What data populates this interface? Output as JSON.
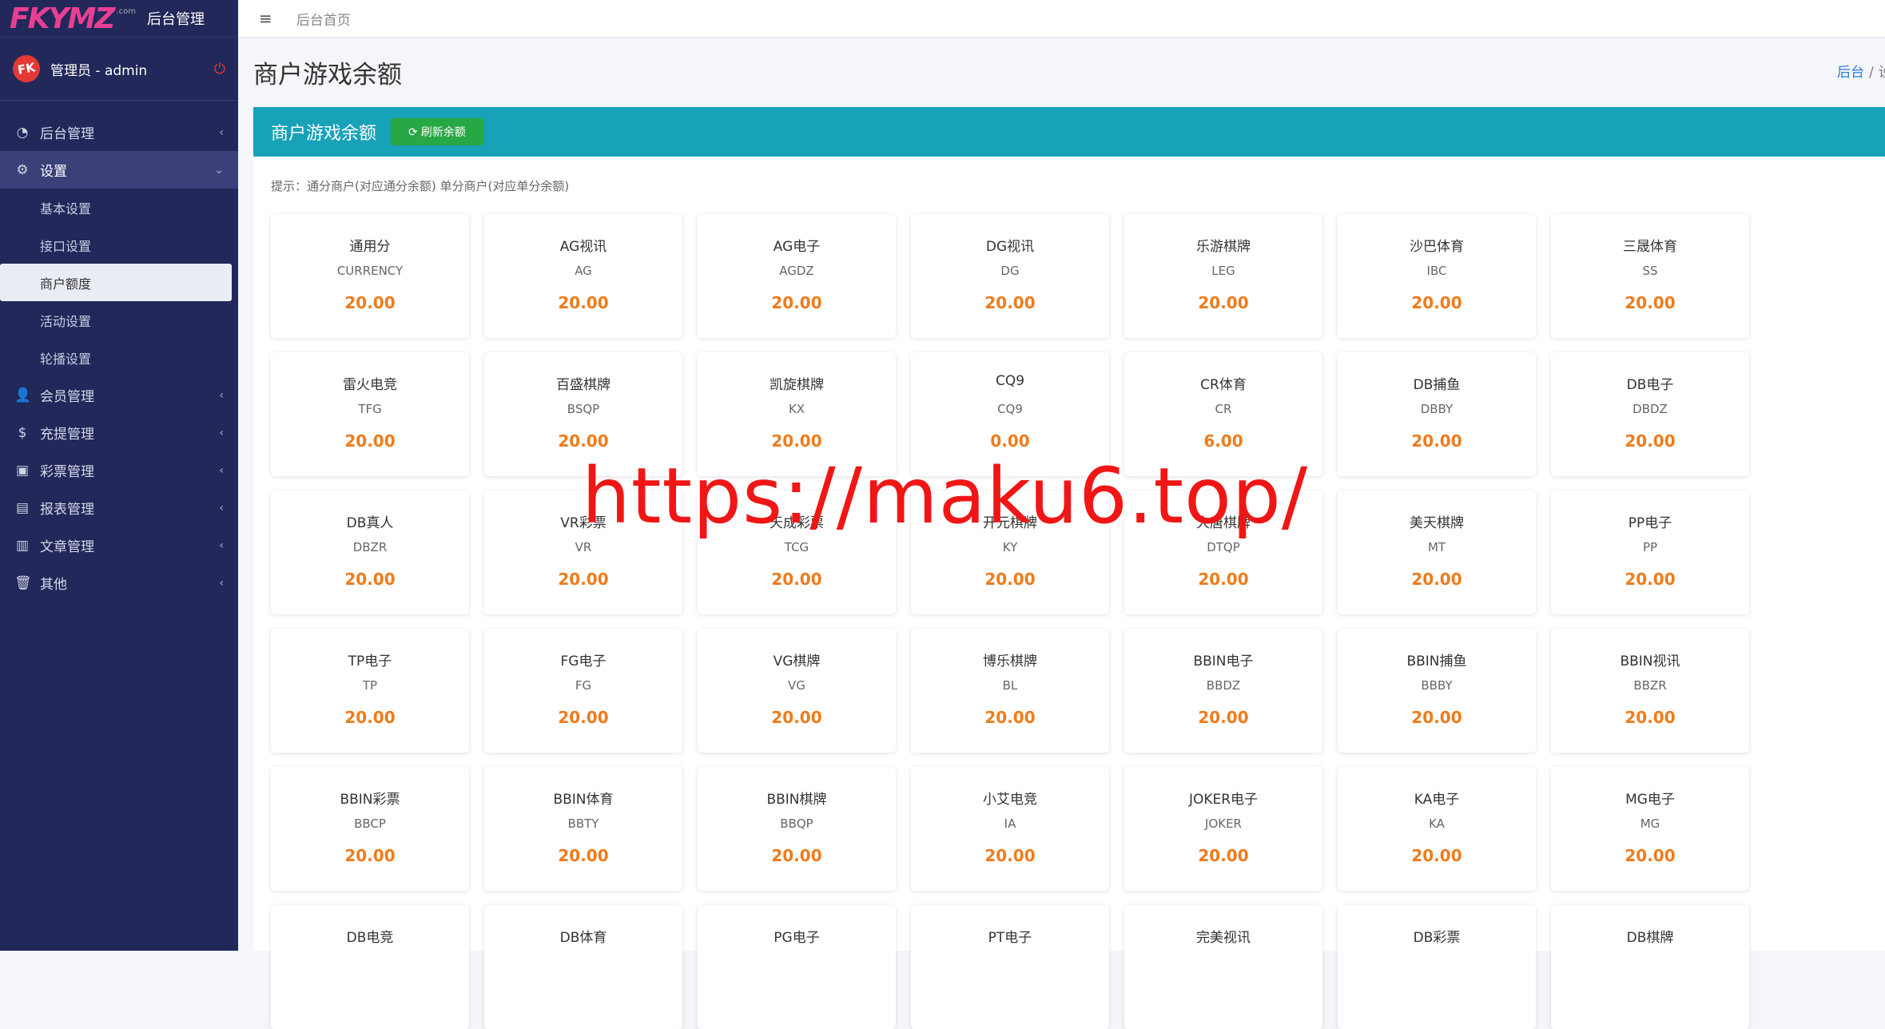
{
  "brand": {
    "logo_text": "FKYMZ",
    "logo_sup": ".com",
    "title": "后台管理"
  },
  "user": {
    "avatar_text": "FK",
    "name": "管理员 - admin"
  },
  "menu": [
    {
      "icon": "tachometer-icon",
      "glyph": "◔",
      "label": "后台管理",
      "type": "parent",
      "state": "collapsed"
    },
    {
      "icon": "gear-icon",
      "glyph": "⚙",
      "label": "设置",
      "type": "parent",
      "state": "expanded"
    },
    {
      "label": "基本设置",
      "type": "sub"
    },
    {
      "label": "接口设置",
      "type": "sub"
    },
    {
      "label": "商户额度",
      "type": "sub",
      "current": true
    },
    {
      "label": "活动设置",
      "type": "sub"
    },
    {
      "label": "轮播设置",
      "type": "sub"
    },
    {
      "icon": "user-icon",
      "glyph": "👤",
      "label": "会员管理",
      "type": "parent",
      "state": "collapsed"
    },
    {
      "icon": "dollar-icon",
      "glyph": "$",
      "label": "充提管理",
      "type": "parent",
      "state": "collapsed"
    },
    {
      "icon": "cc-icon",
      "glyph": "▣",
      "label": "彩票管理",
      "type": "parent",
      "state": "collapsed"
    },
    {
      "icon": "file-icon",
      "glyph": "▤",
      "label": "报表管理",
      "type": "parent",
      "state": "collapsed"
    },
    {
      "icon": "book-icon",
      "glyph": "▥",
      "label": "文章管理",
      "type": "parent",
      "state": "collapsed"
    },
    {
      "icon": "trash-icon",
      "glyph": "🗑",
      "label": "其他",
      "type": "parent",
      "state": "collapsed"
    }
  ],
  "topbar": {
    "crumb": "后台首页"
  },
  "page": {
    "title": "商户游戏余额",
    "breadcrumb_home": "后台",
    "breadcrumb_sep": "/",
    "breadcrumb_rest": "设"
  },
  "panel": {
    "title": "商户游戏余额",
    "refresh_label": "刷新余额",
    "tip": "提示：通分商户(对应通分余额) 单分商户(对应单分余额)"
  },
  "cards": [
    {
      "name": "通用分",
      "code": "CURRENCY",
      "amount": "20.00"
    },
    {
      "name": "AG视讯",
      "code": "AG",
      "amount": "20.00"
    },
    {
      "name": "AG电子",
      "code": "AGDZ",
      "amount": "20.00"
    },
    {
      "name": "DG视讯",
      "code": "DG",
      "amount": "20.00"
    },
    {
      "name": "乐游棋牌",
      "code": "LEG",
      "amount": "20.00"
    },
    {
      "name": "沙巴体育",
      "code": "IBC",
      "amount": "20.00"
    },
    {
      "name": "三晟体育",
      "code": "SS",
      "amount": "20.00"
    },
    {
      "name": "雷火电竞",
      "code": "TFG",
      "amount": "20.00"
    },
    {
      "name": "百盛棋牌",
      "code": "BSQP",
      "amount": "20.00"
    },
    {
      "name": "凯旋棋牌",
      "code": "KX",
      "amount": "20.00"
    },
    {
      "name": "CQ9",
      "code": "CQ9",
      "amount": "0.00"
    },
    {
      "name": "CR体育",
      "code": "CR",
      "amount": "6.00"
    },
    {
      "name": "DB捕鱼",
      "code": "DBBY",
      "amount": "20.00"
    },
    {
      "name": "DB电子",
      "code": "DBDZ",
      "amount": "20.00"
    },
    {
      "name": "DB真人",
      "code": "DBZR",
      "amount": "20.00"
    },
    {
      "name": "VR彩票",
      "code": "VR",
      "amount": "20.00"
    },
    {
      "name": "天成彩票",
      "code": "TCG",
      "amount": "20.00"
    },
    {
      "name": "开元棋牌",
      "code": "KY",
      "amount": "20.00"
    },
    {
      "name": "大唐棋牌",
      "code": "DTQP",
      "amount": "20.00"
    },
    {
      "name": "美天棋牌",
      "code": "MT",
      "amount": "20.00"
    },
    {
      "name": "PP电子",
      "code": "PP",
      "amount": "20.00"
    },
    {
      "name": "TP电子",
      "code": "TP",
      "amount": "20.00"
    },
    {
      "name": "FG电子",
      "code": "FG",
      "amount": "20.00"
    },
    {
      "name": "VG棋牌",
      "code": "VG",
      "amount": "20.00"
    },
    {
      "name": "博乐棋牌",
      "code": "BL",
      "amount": "20.00"
    },
    {
      "name": "BBIN电子",
      "code": "BBDZ",
      "amount": "20.00"
    },
    {
      "name": "BBIN捕鱼",
      "code": "BBBY",
      "amount": "20.00"
    },
    {
      "name": "BBIN视讯",
      "code": "BBZR",
      "amount": "20.00"
    },
    {
      "name": "BBIN彩票",
      "code": "BBCP",
      "amount": "20.00"
    },
    {
      "name": "BBIN体育",
      "code": "BBTY",
      "amount": "20.00"
    },
    {
      "name": "BBIN棋牌",
      "code": "BBQP",
      "amount": "20.00"
    },
    {
      "name": "小艾电竞",
      "code": "IA",
      "amount": "20.00"
    },
    {
      "name": "JOKER电子",
      "code": "JOKER",
      "amount": "20.00"
    },
    {
      "name": "KA电子",
      "code": "KA",
      "amount": "20.00"
    },
    {
      "name": "MG电子",
      "code": "MG",
      "amount": "20.00"
    },
    {
      "name": "DB电竞",
      "code": "",
      "amount": ""
    },
    {
      "name": "DB体育",
      "code": "",
      "amount": ""
    },
    {
      "name": "PG电子",
      "code": "",
      "amount": ""
    },
    {
      "name": "PT电子",
      "code": "",
      "amount": ""
    },
    {
      "name": "完美视讯",
      "code": "",
      "amount": ""
    },
    {
      "name": "DB彩票",
      "code": "",
      "amount": ""
    },
    {
      "name": "DB棋牌",
      "code": "",
      "amount": ""
    }
  ],
  "watermark": "https://maku6.top/",
  "colors": {
    "sidebar": "#22285a",
    "header": "#17a2b8",
    "refresh": "#28a745",
    "amount": "#f07b1b",
    "watermark": "#f01616"
  }
}
